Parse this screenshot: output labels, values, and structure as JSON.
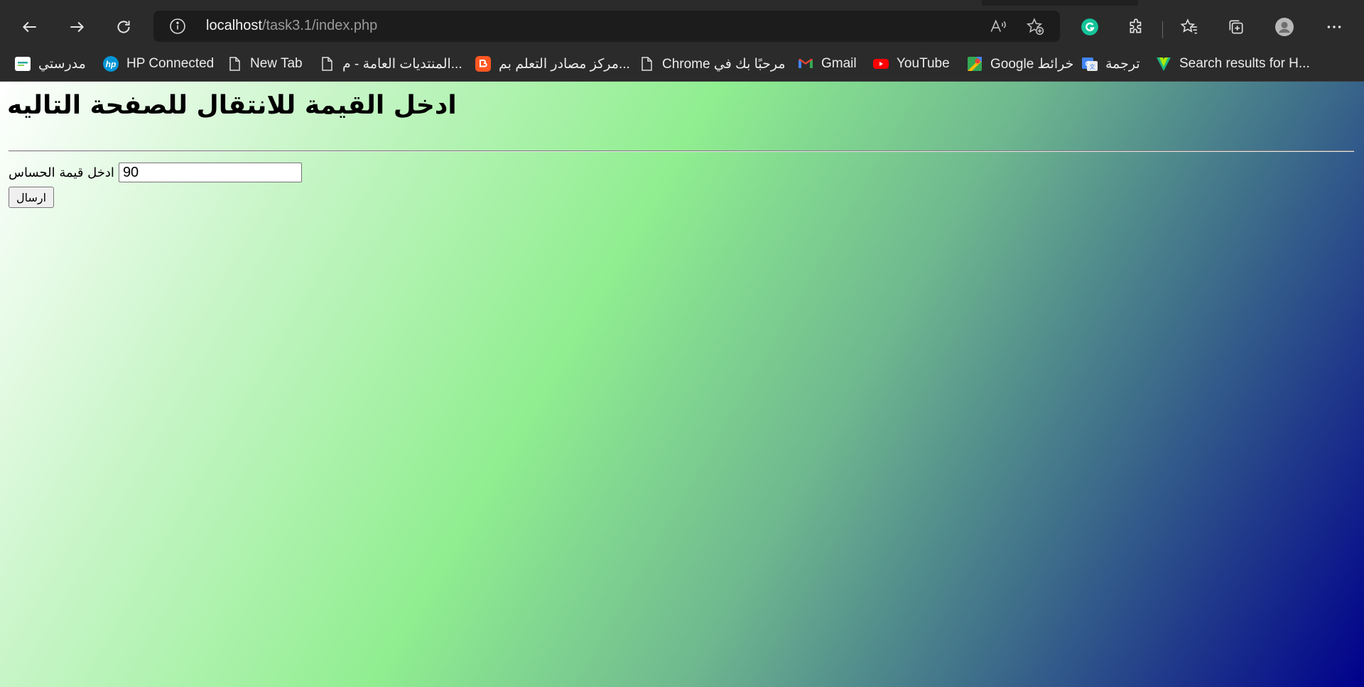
{
  "browser": {
    "url_host": "localhost",
    "url_path": "/task3.1/index.php"
  },
  "bookmarks": [
    {
      "label": "مدرستي",
      "icon": "madrasati-icon"
    },
    {
      "label": "HP Connected",
      "icon": "hp-icon"
    },
    {
      "label": "New Tab",
      "icon": "page-icon"
    },
    {
      "label": "المنتديات العامة - م...",
      "icon": "page-icon"
    },
    {
      "label": "مركز مصادر التعلم بم...",
      "icon": "blogger-icon"
    },
    {
      "label": "Chrome مرحبًا بك في",
      "icon": "page-icon"
    },
    {
      "label": "Gmail",
      "icon": "gmail-icon"
    },
    {
      "label": "YouTube",
      "icon": "youtube-icon"
    },
    {
      "label": "Google خرائط",
      "icon": "maps-icon"
    },
    {
      "label": "ترجمة",
      "icon": "translate-icon"
    },
    {
      "label": "Search results for H...",
      "icon": "vuetify-icon"
    }
  ],
  "content": {
    "heading": "ادخل القيمة للانتقال للصفحة التاليه",
    "field_label": "ادخل قيمة الحساس",
    "field_value": "90",
    "submit_label": "ارسال"
  },
  "colors": {
    "gradient": [
      "#ffffff",
      "#90ee90",
      "#00008b"
    ],
    "chrome_bg": "#2b2b2b"
  }
}
